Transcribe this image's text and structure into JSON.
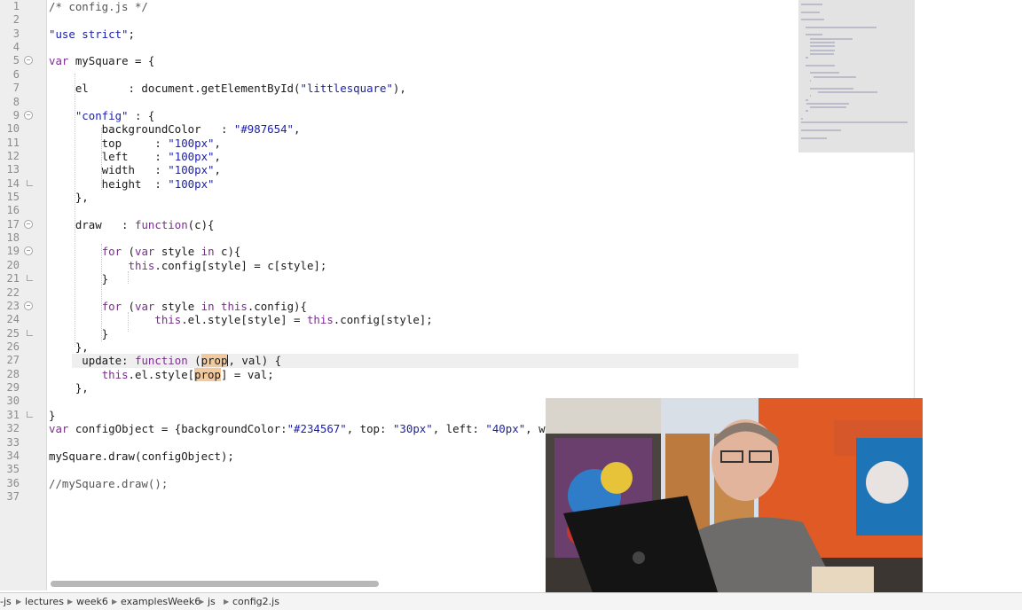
{
  "code_lines": [
    "/* config.js */",
    "",
    "\"use strict\";",
    "",
    "var mySquare = {",
    "",
    "    el      : document.getElementById(\"littlesquare\"),",
    "",
    "    \"config\" : {",
    "        backgroundColor   : \"#987654\",",
    "        top     : \"100px\",",
    "        left    : \"100px\",",
    "        width   : \"100px\",",
    "        height  : \"100px\"",
    "    },",
    "",
    "    draw   : function(c){",
    "",
    "        for (var style in c){",
    "            this.config[style] = c[style];",
    "        }",
    "",
    "        for (var style in this.config){",
    "                this.el.style[style] = this.config[style];",
    "        }",
    "    },",
    "     update: function (prop, val) {",
    "        this.el.style[prop] = val;",
    "    },",
    "",
    "}",
    "var configObject = {backgroundColor:\"#234567\", top: \"30px\", left: \"40px\", w",
    "",
    "mySquare.draw(configObject);",
    "",
    "//mySquare.draw();",
    ""
  ],
  "breadcrumbs": [
    "-js",
    "lectures",
    "week6",
    "examplesWeek6",
    "js",
    "config2.js"
  ],
  "colors": {
    "keyword": "#7a2d8e",
    "string": "#1b1eaa",
    "match_highlight": "#f2c99c"
  },
  "icons": [
    "fold-marker-icon",
    "breadcrumb-arrow-icon"
  ]
}
